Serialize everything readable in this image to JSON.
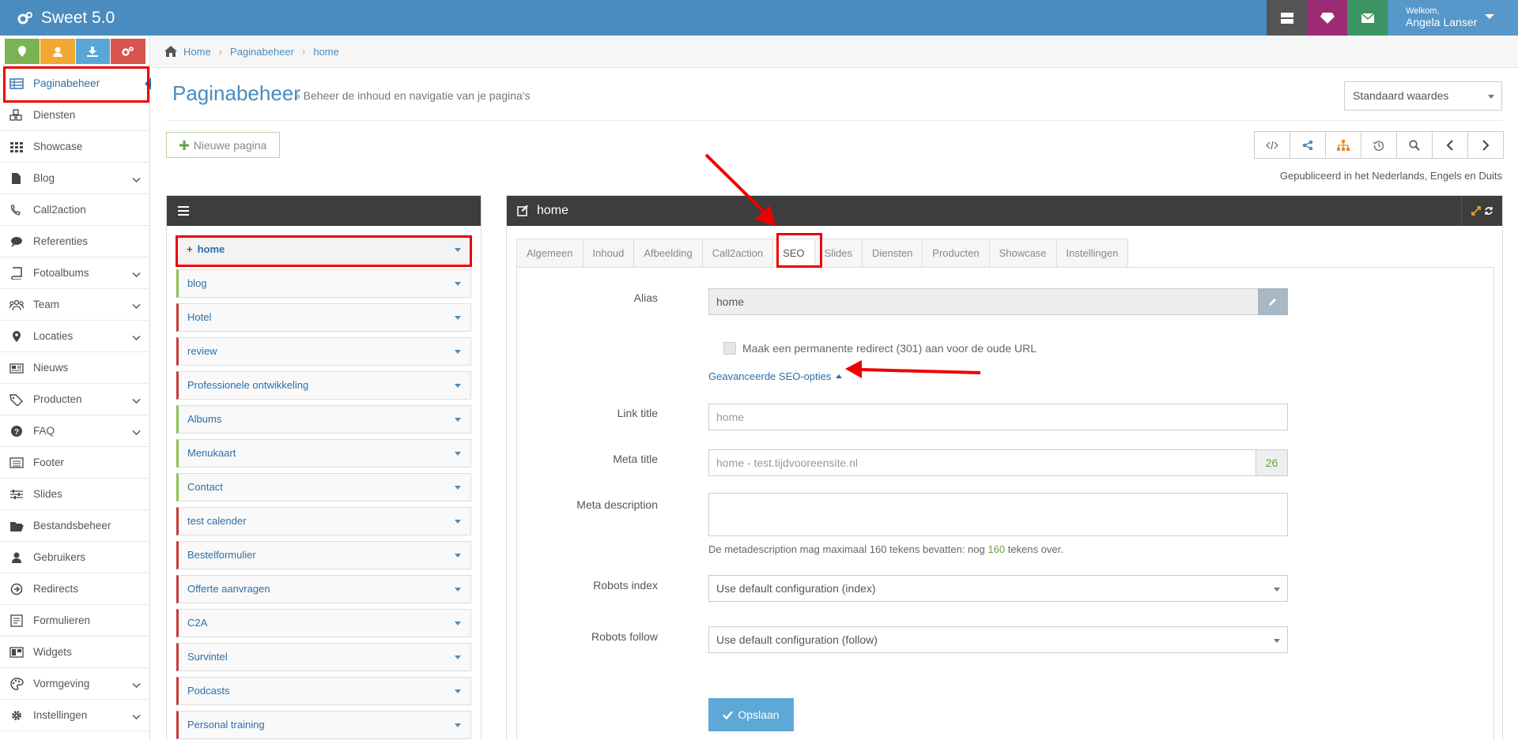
{
  "app": {
    "title": "Sweet 5.0"
  },
  "user": {
    "greeting": "Welkom,",
    "name": "Angela Lanser"
  },
  "topbar": {
    "colors": {
      "icons1": "#555555",
      "icons2": "#9b2c75",
      "icons3": "#3c9462"
    }
  },
  "quick_buttons": [
    {
      "icon": "map-marker-icon",
      "color": "#7ab354"
    },
    {
      "icon": "user-icon",
      "color": "#f0a733"
    },
    {
      "icon": "download-icon",
      "color": "#5aa6d6"
    },
    {
      "icon": "cogs-icon",
      "color": "#d9534f"
    }
  ],
  "sidebar": {
    "items": [
      {
        "label": "Paginabeheer",
        "icon": "table-icon",
        "has_submenu": false,
        "active": true
      },
      {
        "label": "Diensten",
        "icon": "cubes-icon",
        "has_submenu": false
      },
      {
        "label": "Showcase",
        "icon": "grid-icon",
        "has_submenu": false
      },
      {
        "label": "Blog",
        "icon": "file-icon",
        "has_submenu": true
      },
      {
        "label": "Call2action",
        "icon": "phone-icon",
        "has_submenu": false
      },
      {
        "label": "Referenties",
        "icon": "comments-icon",
        "has_submenu": false
      },
      {
        "label": "Fotoalbums",
        "icon": "book-icon",
        "has_submenu": true
      },
      {
        "label": "Team",
        "icon": "users-icon",
        "has_submenu": true
      },
      {
        "label": "Locaties",
        "icon": "map-marker-icon",
        "has_submenu": true
      },
      {
        "label": "Nieuws",
        "icon": "newspaper-icon",
        "has_submenu": false
      },
      {
        "label": "Producten",
        "icon": "tags-icon",
        "has_submenu": true
      },
      {
        "label": "FAQ",
        "icon": "question-icon",
        "has_submenu": true
      },
      {
        "label": "Footer",
        "icon": "list-alt-icon",
        "has_submenu": false
      },
      {
        "label": "Slides",
        "icon": "sliders-icon",
        "has_submenu": false
      },
      {
        "label": "Bestandsbeheer",
        "icon": "folder-open-icon",
        "has_submenu": false
      },
      {
        "label": "Gebruikers",
        "icon": "user-icon",
        "has_submenu": false
      },
      {
        "label": "Redirects",
        "icon": "arrow-circle-icon",
        "has_submenu": false
      },
      {
        "label": "Formulieren",
        "icon": "form-icon",
        "has_submenu": false
      },
      {
        "label": "Widgets",
        "icon": "widget-icon",
        "has_submenu": false
      },
      {
        "label": "Vormgeving",
        "icon": "palette-icon",
        "has_submenu": true
      },
      {
        "label": "Instellingen",
        "icon": "gear-icon",
        "has_submenu": true
      }
    ]
  },
  "breadcrumb": [
    "Paginabeheer",
    "home"
  ],
  "breadcrumb_home": "Home",
  "header": {
    "title": "Paginabeheer",
    "subtitle": "» Beheer de inhoud en navigatie van je pagina's",
    "defaults_select": "Standaard waardes"
  },
  "actions": {
    "new_page": "Nieuwe pagina",
    "published": "Gepubliceerd in het Nederlands, Engels en Duits",
    "tools": [
      "code-icon",
      "share-icon",
      "sitemap-icon",
      "history-icon",
      "search-icon",
      "chevron-left-icon",
      "chevron-right-icon"
    ]
  },
  "tree": {
    "items": [
      {
        "label": "home",
        "accent": "none"
      },
      {
        "label": "blog",
        "accent": "green"
      },
      {
        "label": "Hotel",
        "accent": "red"
      },
      {
        "label": "review",
        "accent": "red"
      },
      {
        "label": "Professionele ontwikkeling",
        "accent": "red"
      },
      {
        "label": "Albums",
        "accent": "green"
      },
      {
        "label": "Menukaart",
        "accent": "green"
      },
      {
        "label": "Contact",
        "accent": "green"
      },
      {
        "label": "test calender",
        "accent": "red"
      },
      {
        "label": "Bestelformulier",
        "accent": "red"
      },
      {
        "label": "Offerte aanvragen",
        "accent": "red"
      },
      {
        "label": "C2A",
        "accent": "red"
      },
      {
        "label": "Survintel",
        "accent": "red"
      },
      {
        "label": "Podcasts",
        "accent": "red"
      },
      {
        "label": "Personal training",
        "accent": "red"
      }
    ]
  },
  "editor": {
    "title": "home",
    "tabs": [
      "Algemeen",
      "Inhoud",
      "Afbeelding",
      "Call2action",
      "SEO",
      "Slides",
      "Diensten",
      "Producten",
      "Showcase",
      "Instellingen"
    ],
    "active_tab": "SEO",
    "alias_label": "Alias",
    "alias_value": "home",
    "redirect_checkbox": "Maak een permanente redirect (301) aan voor de oude URL",
    "advanced_toggle": "Geavanceerde SEO-opties",
    "link_title_label": "Link title",
    "link_title_placeholder": "home",
    "meta_title_label": "Meta title",
    "meta_title_placeholder": "home - test.tijdvooreensite.nl",
    "meta_title_count": "26",
    "meta_description_label": "Meta description",
    "meta_hint_before": "De metadescription mag maximaal 160 tekens bevatten: nog",
    "meta_hint_count": "160",
    "meta_hint_after": "tekens over.",
    "robots_index_label": "Robots index",
    "robots_index_value": "Use default configuration (index)",
    "robots_follow_label": "Robots follow",
    "robots_follow_value": "Use default configuration (follow)",
    "save": "Opslaan"
  }
}
